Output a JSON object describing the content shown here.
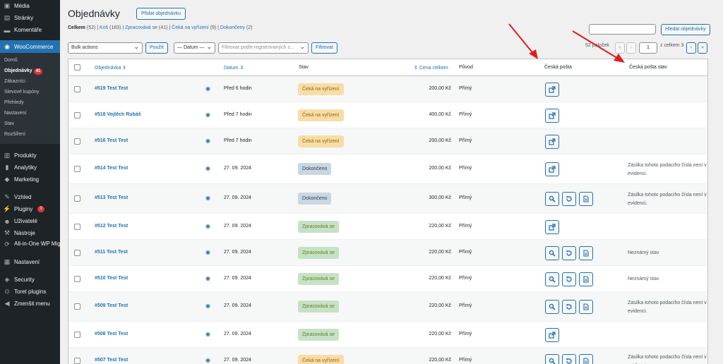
{
  "sidebar": {
    "top": [
      {
        "label": "Média",
        "icon": "media-icon"
      },
      {
        "label": "Stránky",
        "icon": "pages-icon"
      },
      {
        "label": "Komentáře",
        "icon": "comments-icon"
      }
    ],
    "woo": {
      "label": "WooCommerce",
      "icon": "woo-icon"
    },
    "woo_sub": [
      {
        "label": "Domů"
      },
      {
        "label": "Objednávky",
        "badge": "41",
        "current": true
      },
      {
        "label": "Zákazníci"
      },
      {
        "label": "Slevové kupóny"
      },
      {
        "label": "Přehledy"
      },
      {
        "label": "Nastavení"
      },
      {
        "label": "Stav"
      },
      {
        "label": "Rozšíření"
      }
    ],
    "mid": [
      {
        "label": "Produkty",
        "icon": "products-icon"
      },
      {
        "label": "Analytiky",
        "icon": "analytics-icon"
      },
      {
        "label": "Marketing",
        "icon": "marketing-icon"
      }
    ],
    "lower": [
      {
        "label": "Vzhled",
        "icon": "appearance-icon"
      },
      {
        "label": "Pluginy",
        "icon": "plugins-icon",
        "badge": "3"
      },
      {
        "label": "Uživatelé",
        "icon": "users-icon"
      },
      {
        "label": "Nástroje",
        "icon": "tools-icon"
      },
      {
        "label": "All-in-One WP Migration",
        "icon": "migration-icon"
      },
      {
        "label": "Nastavení",
        "icon": "settings-icon"
      }
    ],
    "bottom": [
      {
        "label": "Security",
        "icon": "security-icon"
      },
      {
        "label": "Toret plugins",
        "icon": "toret-icon"
      },
      {
        "label": "Zmenšit menu",
        "icon": "collapse-icon"
      }
    ]
  },
  "header": {
    "title": "Objednávky",
    "add_label": "Přidat objednávku"
  },
  "filters": {
    "all_label": "Celkem",
    "all_count": "(52)",
    "trash_label": "Koš",
    "trash_count": "(183)",
    "processing_label": "Zpracovává se",
    "processing_count": "(41)",
    "onhold_label": "Čeká na vyřízení",
    "onhold_count": "(9)",
    "completed_label": "Dokončeny",
    "completed_count": "(2)"
  },
  "search": {
    "button": "Hledat objednávky"
  },
  "toolbar": {
    "bulk": "Bulk actions",
    "apply": "Použít",
    "date": "— Datum —",
    "customer": "Filtrovat podle registrovaných z...",
    "filter": "Filtrovat"
  },
  "pagination": {
    "count": "52 položek",
    "first": "«",
    "prev": "‹",
    "current": "1",
    "total": "z celkem 3",
    "next": "›",
    "last": "»"
  },
  "columns": {
    "order": "Objednávka",
    "date": "Datum",
    "status": "Stav",
    "total": "Cena celkem",
    "origin": "Původ",
    "cp": "Česká pošta",
    "cp_status": "Česká pošta stav"
  },
  "rows": [
    {
      "order": "#519 Test Test",
      "date": "Před 6 hodin",
      "status": "Čeká na vyřízení",
      "status_type": "wait",
      "total": "200,00 Kč",
      "origin": "Přímý",
      "actions": [
        "export"
      ],
      "cp_status": ""
    },
    {
      "order": "#518 Vojtěch Rubáš",
      "date": "Před 7 hodin",
      "status": "Čeká na vyřízení",
      "status_type": "wait",
      "total": "400,00 Kč",
      "origin": "Přímý",
      "actions": [
        "export"
      ],
      "cp_status": ""
    },
    {
      "order": "#516 Test Test",
      "date": "Před 7 hodin",
      "status": "Čeká na vyřízení",
      "status_type": "wait",
      "total": "200,00 Kč",
      "origin": "Přímý",
      "actions": [
        "export"
      ],
      "cp_status": ""
    },
    {
      "order": "#514 Test Test",
      "date": "27. 09. 2024",
      "status": "Dokončeno",
      "status_type": "done",
      "total": "200,00 Kč",
      "origin": "Přímý",
      "actions": [
        "export"
      ],
      "cp_status": "Zásilka tohoto podacího čísla není v evidenci."
    },
    {
      "order": "#513 Test Test",
      "date": "27. 09. 2024",
      "status": "Dokončeno",
      "status_type": "done",
      "total": "300,00 Kč",
      "origin": "Přímý",
      "actions": [
        "search",
        "refresh",
        "doc"
      ],
      "cp_status": "Zásilka tohoto podacího čísla není v evidenci."
    },
    {
      "order": "#512 Test Test",
      "date": "27. 09. 2024",
      "status": "Zpracovává se",
      "status_type": "proc",
      "total": "220,00 Kč",
      "origin": "Přímý",
      "actions": [
        "export"
      ],
      "cp_status": ""
    },
    {
      "order": "#511 Test Test",
      "date": "27. 09. 2024",
      "status": "Zpracovává se",
      "status_type": "proc",
      "total": "220,00 Kč",
      "origin": "Přímý",
      "actions": [
        "search",
        "refresh",
        "doc"
      ],
      "cp_status": "Neznámý stav"
    },
    {
      "order": "#510 Test Test",
      "date": "27. 09. 2024",
      "status": "Zpracovává se",
      "status_type": "proc",
      "total": "220,00 Kč",
      "origin": "Přímý",
      "actions": [
        "search",
        "refresh",
        "doc"
      ],
      "cp_status": "Neznámý stav"
    },
    {
      "order": "#509 Test Test",
      "date": "27. 09. 2024",
      "status": "Zpracovává se",
      "status_type": "proc",
      "total": "220,00 Kč",
      "origin": "Přímý",
      "actions": [
        "search",
        "refresh",
        "doc"
      ],
      "cp_status": "Zásilka tohoto podacího čísla není v evidenci."
    },
    {
      "order": "#508 Test Test",
      "date": "27. 09. 2024",
      "status": "Zpracovává se",
      "status_type": "proc",
      "total": "220,00 Kč",
      "origin": "Přímý",
      "actions": [
        "export"
      ],
      "cp_status": ""
    },
    {
      "order": "#507 Test Test",
      "date": "27. 09. 2024",
      "status": "Čeká na vyřízení",
      "status_type": "wait",
      "total": "220,00 Kč",
      "origin": "Přímý",
      "actions": [
        "search",
        "refresh",
        "doc"
      ],
      "cp_status": "Zásilka tohoto podacího čísla není v evidenci."
    }
  ],
  "annotation": {
    "arrow_color": "#e01e1e"
  }
}
